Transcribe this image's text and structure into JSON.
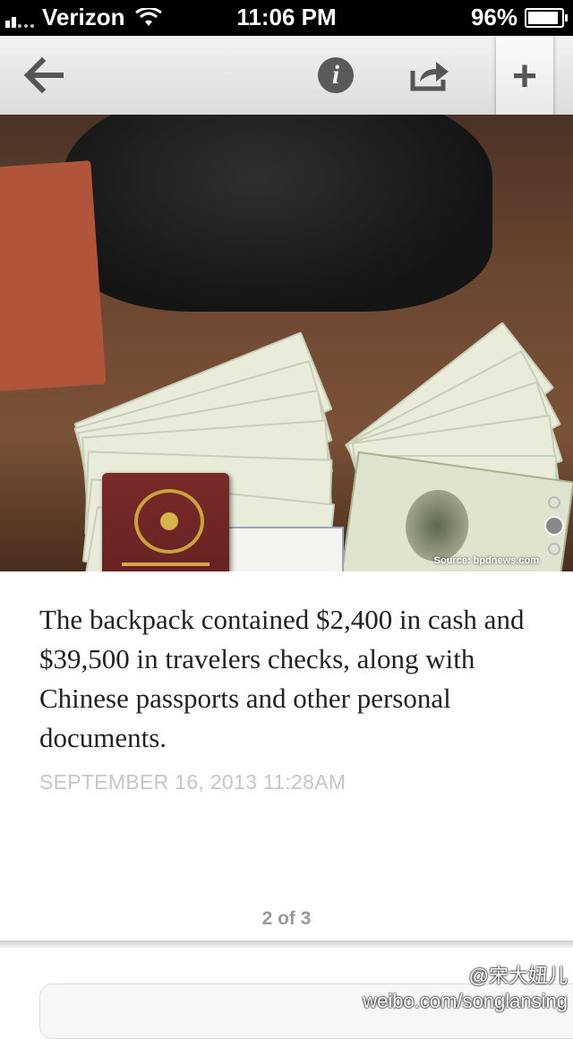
{
  "status_bar": {
    "carrier": "Verizon",
    "time": "11:06 PM",
    "battery": "96%",
    "battery_level": 0.96
  },
  "toolbar": {
    "back_icon": "arrow-left-icon",
    "info_glyph": "i",
    "share_icon": "share-icon",
    "add_glyph": "+"
  },
  "photo": {
    "credit": "Source: bpdnews.com",
    "pager": {
      "total": 3,
      "active": 2
    }
  },
  "article": {
    "caption": "The backpack contained $2,400 in cash and $39,500 in travelers checks, along with Chinese passports and other personal documents.",
    "timestamp": "SEPTEMBER 16, 2013 11:28AM",
    "page_count": "2 of 3"
  },
  "watermark": {
    "handle": "@宋大妞儿",
    "url": "weibo.com/songlansing"
  },
  "colors": {
    "caption_text": "#222222",
    "timestamp_text": "#c6c6c6",
    "toolbar_bg": "#e6e6e6"
  }
}
